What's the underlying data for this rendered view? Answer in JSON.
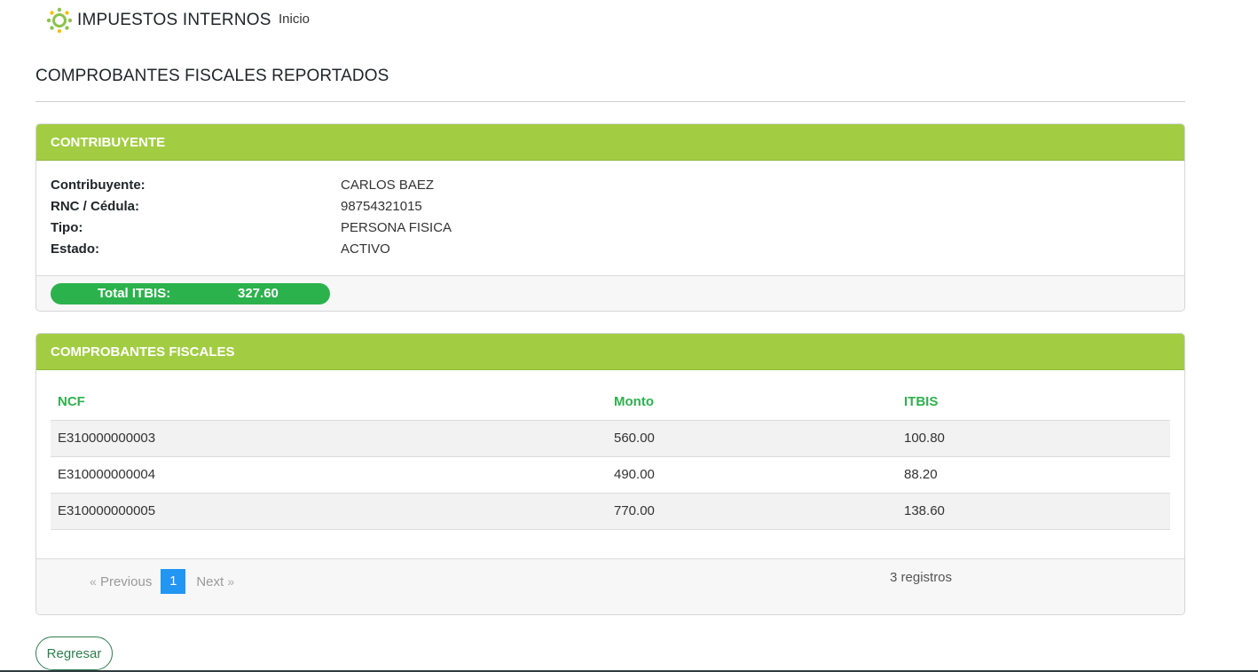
{
  "navbar": {
    "brand_text": "IMPUESTOS INTERNOS",
    "logo_icon": "sun-logo-icon",
    "links": [
      {
        "label": "Inicio"
      }
    ]
  },
  "page": {
    "title": "COMPROBANTES FISCALES REPORTADOS"
  },
  "taxpayer": {
    "header": "CONTRIBUYENTE",
    "fields": [
      {
        "label": "Contribuyente:",
        "value": "CARLOS BAEZ"
      },
      {
        "label": "RNC / Cédula:",
        "value": "98754321015"
      },
      {
        "label": "Tipo:",
        "value": "PERSONA FISICA"
      },
      {
        "label": "Estado:",
        "value": "ACTIVO"
      }
    ],
    "total_label": "Total ITBIS:",
    "total_value": "327.60"
  },
  "receipts": {
    "header": "COMPROBANTES FISCALES",
    "columns": [
      "NCF",
      "Monto",
      "ITBIS"
    ],
    "rows": [
      [
        "E310000000003",
        "560.00",
        "100.80"
      ],
      [
        "E310000000004",
        "490.00",
        "88.20"
      ],
      [
        "E310000000005",
        "770.00",
        "138.60"
      ]
    ],
    "pagination": {
      "prev_arrow": "«",
      "prev_label": "Previous",
      "current_page": "1",
      "next_label": "Next",
      "next_arrow": "»"
    },
    "records_text": "3 registros"
  },
  "actions": {
    "back_label": "Regresar"
  },
  "colors": {
    "header_green": "#a2cd42",
    "accent_green": "#2cb24c",
    "page_active_blue": "#2196f3",
    "button_green": "#2e7d4f"
  }
}
